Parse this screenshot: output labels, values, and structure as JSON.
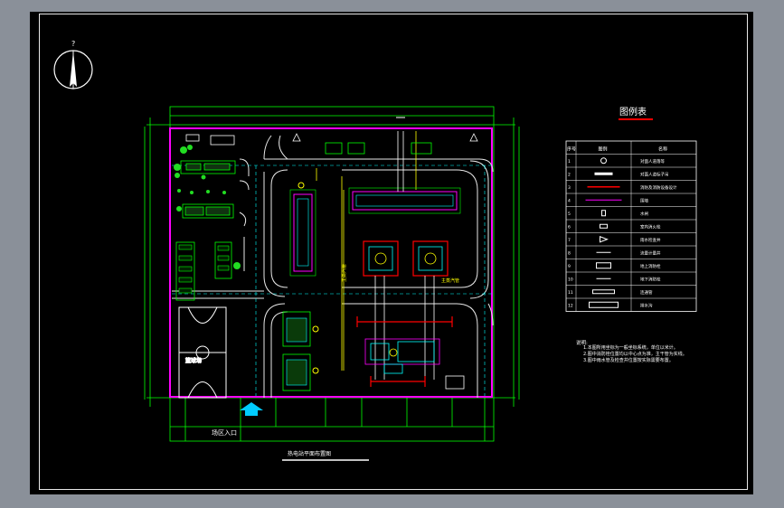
{
  "north_arrow": {
    "label": "?"
  },
  "site_entrance": {
    "label": "场区入口"
  },
  "plan_title": {
    "label": "热电站平面布置图"
  },
  "legend": {
    "title": "图例表",
    "headers": [
      "序号",
      "图例",
      "名称"
    ],
    "rows": [
      {
        "no": "1",
        "name": "对面人道落等"
      },
      {
        "no": "2",
        "name": "对面人道标子吊"
      },
      {
        "no": "3",
        "name": "消防及消防设备设计"
      },
      {
        "no": "4",
        "name": "围墙"
      },
      {
        "no": "5",
        "name": "水闸"
      },
      {
        "no": "6",
        "name": "室内消火栓"
      },
      {
        "no": "7",
        "name": "雨水检查井"
      },
      {
        "no": "8",
        "name": "流量计量井"
      },
      {
        "no": "9",
        "name": "地上消防栓"
      },
      {
        "no": "10",
        "name": "地下消防栓"
      },
      {
        "no": "11",
        "name": "连通管"
      },
      {
        "no": "12",
        "name": "排水沟"
      }
    ]
  },
  "notes": {
    "title": "说明:",
    "lines": [
      "1.本图所用坐标为一般坐标系统，单位以米计。",
      "2.图中消防栓位置均以中心点为准，主干管为实线。",
      "3.图中雨水管及检查井位置按实际需要布置。"
    ]
  },
  "labels": {
    "basketball_court": "篮球场",
    "feed_a": "主蒸汽管",
    "feed_b": "主蒸汽管",
    "coal_bay": "煤场"
  },
  "colors": {
    "background": "#000000",
    "boundary": "#ff00ff",
    "road": "#ffffff",
    "grid": "#00ff00",
    "piping": "#ff0000",
    "cyan": "#00ffff",
    "yellow": "#ffff00"
  }
}
